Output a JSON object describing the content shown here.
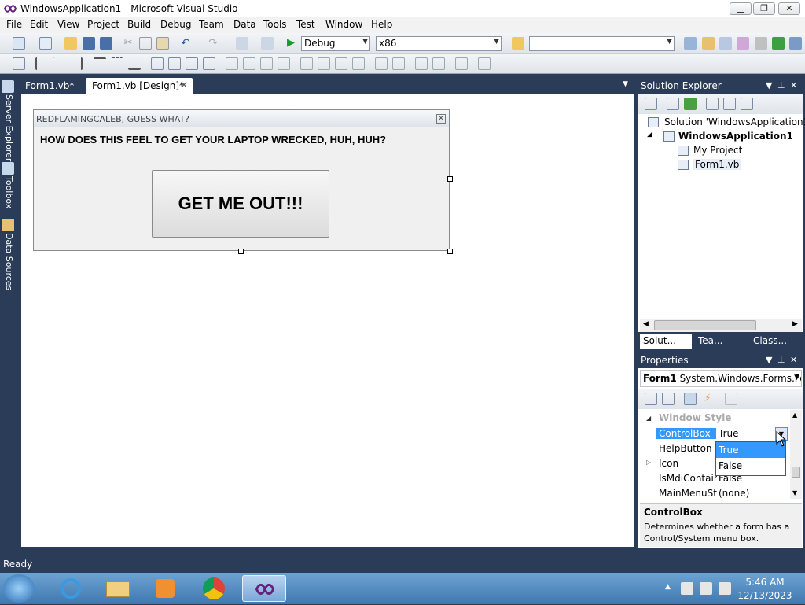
{
  "window": {
    "title": "WindowsApplication1 - Microsoft Visual Studio",
    "minimize": "▁",
    "maximize": "❐",
    "close": "✕"
  },
  "menu": [
    "File",
    "Edit",
    "View",
    "Project",
    "Build",
    "Debug",
    "Team",
    "Data",
    "Tools",
    "Test",
    "Window",
    "Help"
  ],
  "toolbar": {
    "config": "Debug",
    "platform": "x86",
    "find": ""
  },
  "left_strip": [
    "Server Explorer",
    "Toolbox",
    "Data Sources"
  ],
  "doc_tabs": [
    "Form1.vb*",
    "Form1.vb [Design]*"
  ],
  "designer_form": {
    "caption": "REDFLAMINGCALEB, GUESS WHAT?",
    "label": "HOW DOES THIS FEEL TO GET YOUR LAPTOP WRECKED, HUH, HUH?",
    "button": "GET ME OUT!!!"
  },
  "solution_explorer": {
    "title": "Solution Explorer",
    "items": [
      "Solution 'WindowsApplication1'",
      "WindowsApplication1",
      "My Project",
      "Form1.vb"
    ],
    "tabs": [
      "Solut...",
      "Tea...",
      "Class..."
    ]
  },
  "properties": {
    "title": "Properties",
    "object_name": "Form1",
    "object_type": "System.Windows.Forms.Fo",
    "category": "Window Style",
    "rows": [
      {
        "name": "ControlBox",
        "value": "True"
      },
      {
        "name": "HelpButton",
        "value": ""
      },
      {
        "name": "Icon",
        "value": ""
      },
      {
        "name": "IsMdiContain",
        "value": "False"
      },
      {
        "name": "MainMenuStr",
        "value": "(none)"
      }
    ],
    "dropdown_options": [
      "True",
      "False"
    ],
    "desc_title": "ControlBox",
    "desc_text": "Determines whether a form has a Control/System menu box."
  },
  "status": "Ready",
  "clock": {
    "time": "5:46 AM",
    "date": "12/13/2023"
  },
  "colors": {
    "vs_dark": "#2b3c59",
    "selection": "#3399ff"
  }
}
